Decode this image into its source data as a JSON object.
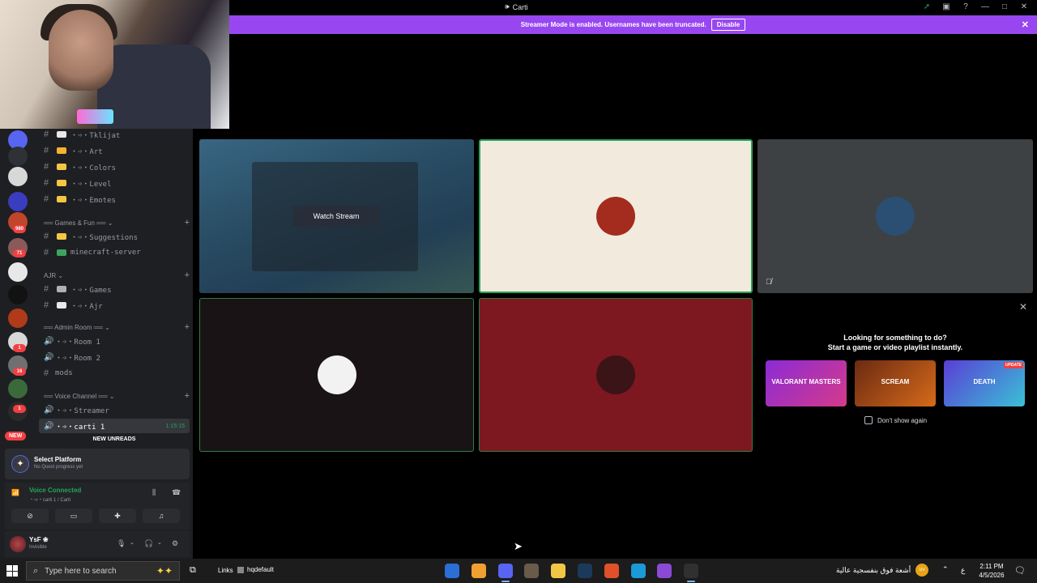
{
  "window": {
    "title": "Carti",
    "banner_text": "Streamer Mode is enabled. Usernames have been truncated.",
    "banner_button": "Disable"
  },
  "rail": {
    "badges": [
      "980",
      "71",
      "1",
      "16",
      "1"
    ],
    "new_label": "NEW"
  },
  "channels": [
    {
      "name": "・➩・Tklijat",
      "icon": "document-icon",
      "color": "#e8e8e8"
    },
    {
      "name": "・➩・Art",
      "icon": "face-icon",
      "color": "#f2b233"
    },
    {
      "name": "・➩・Colors",
      "icon": "face-icon",
      "color": "#f2c744"
    },
    {
      "name": "・➩・Level",
      "icon": "lightning-icon",
      "color": "#f2c744"
    },
    {
      "name": "・➩・Emotes",
      "icon": "sparkle-icon",
      "color": "#f2c744"
    }
  ],
  "categories": {
    "games": "══ Games & Fun ══ ⌄",
    "ajr": "AJR ⌄",
    "admin": "══ Admin Room ══ ⌄",
    "voice": "══ Voice Channel ══ ⌄"
  },
  "games_channels": [
    {
      "name": "・➩・Suggestions",
      "icon": "hand-icon",
      "color": "#f2c744"
    },
    {
      "name": "minecraft-server",
      "icon": "puzzle-icon",
      "color": "#3ba55d"
    }
  ],
  "ajr_channels": [
    {
      "name": "・➩・Games",
      "icon": "joystick-icon",
      "color": "#b0b0b0"
    },
    {
      "name": "・➩・Ajr",
      "icon": "eyes-icon",
      "color": "#e8e8e8"
    }
  ],
  "admin_channels": [
    {
      "name": "・➩・Room 1"
    },
    {
      "name": "・➩・Room 2"
    },
    {
      "name": "mods"
    }
  ],
  "voice_channels": [
    {
      "name": "・➩・Streamer"
    },
    {
      "name": "・➩・carti 1",
      "timer": "1:15:15"
    }
  ],
  "new_unreads": "NEW UNREADS",
  "quest": {
    "title": "Select Platform",
    "subtitle": "No Quest progress yet"
  },
  "voice": {
    "status": "Voice Connected",
    "channel": "・➩・carti 1 / Carti"
  },
  "user": {
    "name": "YsF ❀",
    "status": "Invisible"
  },
  "stream": {
    "watch_label": "Watch Stream"
  },
  "tiles": [
    {
      "id": "stream",
      "bg": "#2b4a5e"
    },
    {
      "id": "user-2",
      "bg": "#f2eadd",
      "avatar": "#a32c1f"
    },
    {
      "id": "user-3",
      "bg": "#3e4143",
      "avatar": "#2a4f73"
    },
    {
      "id": "user-4",
      "bg": "#191316",
      "avatar": "#f2f2f2"
    },
    {
      "id": "user-5",
      "bg": "#7d1820",
      "avatar": "#3a1416"
    }
  ],
  "activity": {
    "line1": "Looking for something to do?",
    "line2": "Start a game or video playlist instantly.",
    "cards": [
      {
        "label": "VALORANT MASTERS",
        "color": "#8a2bd6"
      },
      {
        "label": "SCREAM",
        "color": "#6b2a12"
      },
      {
        "label": "DEATH",
        "color": "#5a3ed6",
        "badge": "UPDATE"
      }
    ],
    "checkbox": "Don't show again"
  },
  "taskbar": {
    "search_placeholder": "Type here to search",
    "links": "Links",
    "hq": "hqdefault",
    "weather": "أشعة فوق بنفسجية عالية",
    "weather_badge": "UV",
    "lang": "ع",
    "time": "2:11 PM",
    "date": "4/5/2026",
    "apps": [
      {
        "name": "outlook",
        "color": "#2b6fd6"
      },
      {
        "name": "orange-app",
        "color": "#f0a030"
      },
      {
        "name": "discord",
        "color": "#5865f2",
        "active": true
      },
      {
        "name": "photo-app",
        "color": "#6a5a4a"
      },
      {
        "name": "file-explorer",
        "color": "#f2c744"
      },
      {
        "name": "steam",
        "color": "#1b3a5a"
      },
      {
        "name": "red-app",
        "color": "#e0502a"
      },
      {
        "name": "edge",
        "color": "#1a9ad6"
      },
      {
        "name": "purple-app",
        "color": "#8a4ad6"
      },
      {
        "name": "obs",
        "color": "#303030",
        "active": true
      }
    ]
  }
}
